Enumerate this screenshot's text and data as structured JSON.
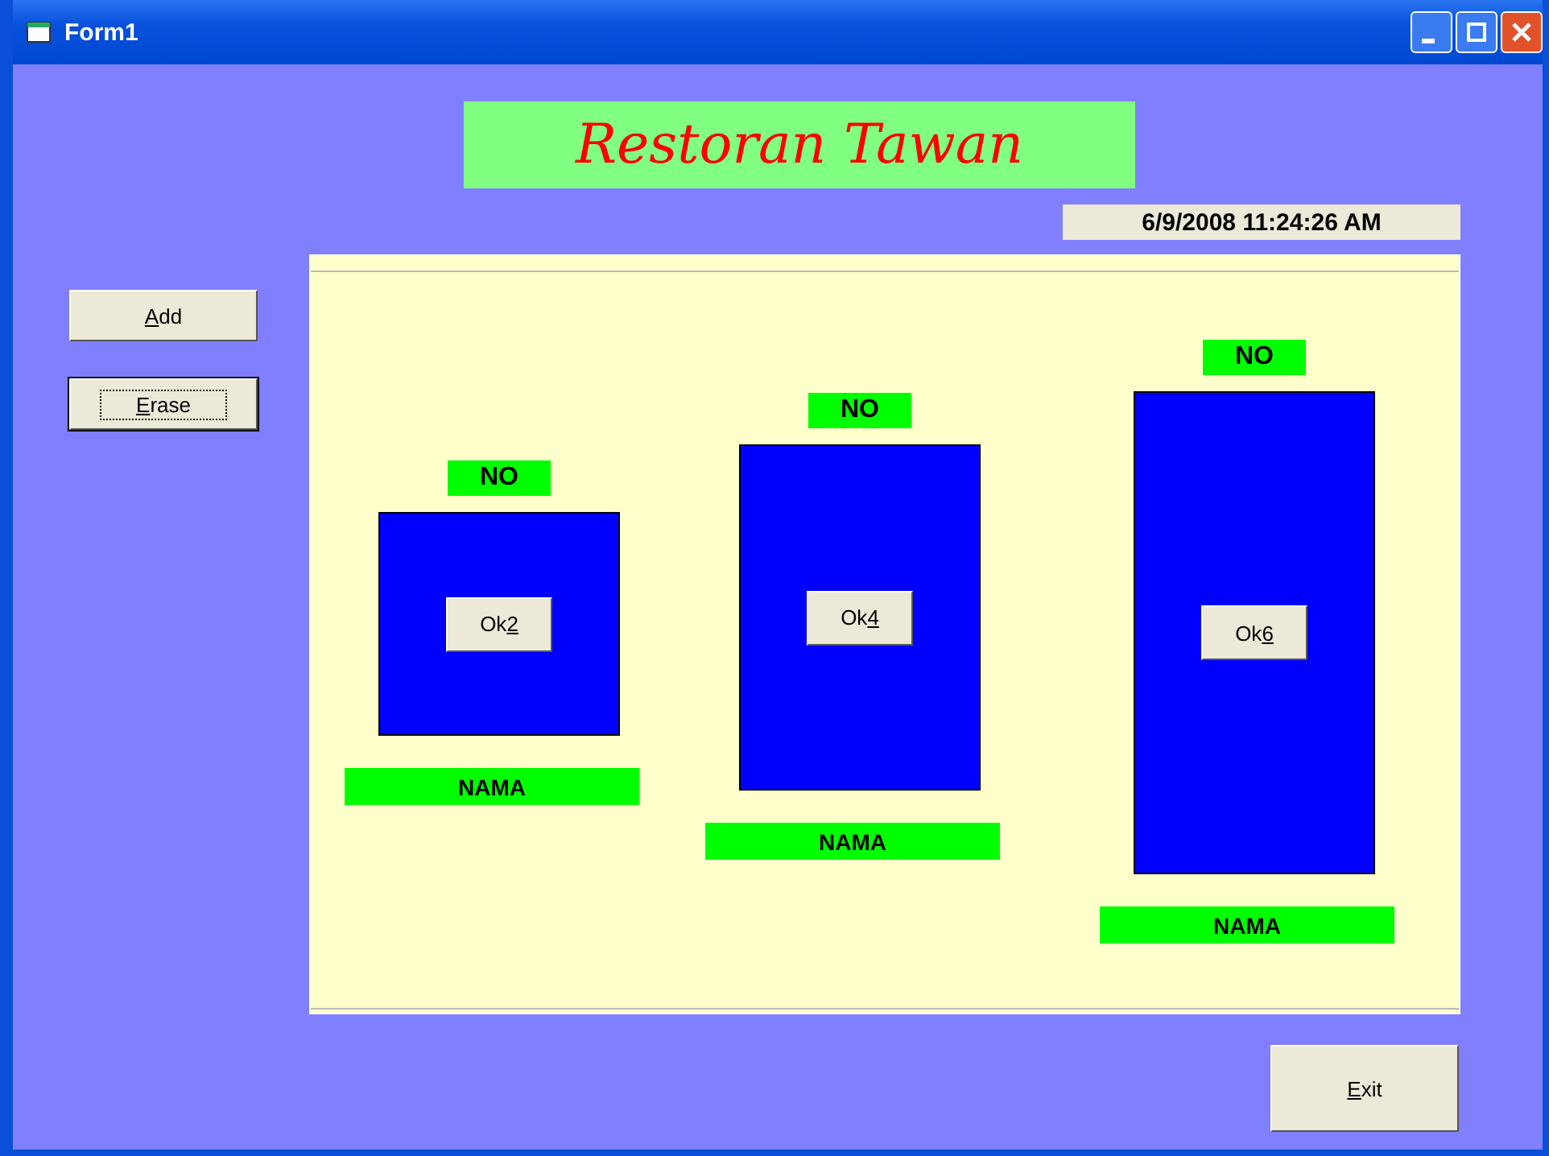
{
  "window": {
    "title": "Form1"
  },
  "heading": "Restoran Tawan",
  "datetime": "6/9/2008 11:24:26 AM",
  "side_buttons": [
    {
      "key": "A",
      "after": "dd",
      "focused": false
    },
    {
      "key": "E",
      "after": "rase",
      "focused": true
    }
  ],
  "tables": [
    {
      "kind": "small",
      "status": "NO",
      "button": {
        "before": "Ok",
        "key": "2"
      },
      "name": "NAMA"
    },
    {
      "kind": "medium",
      "status": "NO",
      "button": {
        "before": "Ok",
        "key": "4"
      },
      "name": "NAMA"
    },
    {
      "kind": "large",
      "status": "NO",
      "button": {
        "before": "Ok",
        "key": "6"
      },
      "name": "NAMA"
    }
  ],
  "exit_button": {
    "key": "E",
    "after": "xit"
  }
}
